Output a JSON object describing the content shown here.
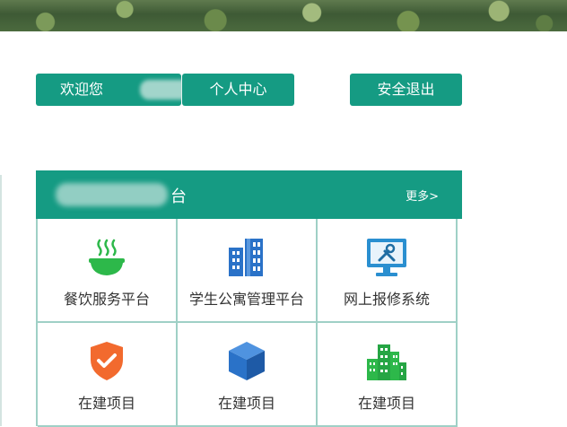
{
  "header": {
    "welcome_label": "欢迎您",
    "profile_label": "个人中心",
    "logout_label": "安全退出"
  },
  "panel": {
    "title_suffix": "台",
    "more_label": "更多>"
  },
  "tiles": [
    {
      "label": "餐饮服务平台",
      "icon": "rice-bowl-icon",
      "color": "#2db84a"
    },
    {
      "label": "学生公寓管理平台",
      "icon": "apartment-building-icon",
      "color": "#2a72c8"
    },
    {
      "label": "网上报修系统",
      "icon": "repair-monitor-icon",
      "color": "#2a8fd0"
    },
    {
      "label": "在建项目",
      "icon": "shield-check-icon",
      "color": "#f26a2e"
    },
    {
      "label": "在建项目",
      "icon": "cube-icon",
      "color": "#2a72c8"
    },
    {
      "label": "在建项目",
      "icon": "city-buildings-icon",
      "color": "#2db84a"
    }
  ],
  "colors": {
    "accent": "#159b83",
    "grid_border": "#9fd0c6"
  }
}
